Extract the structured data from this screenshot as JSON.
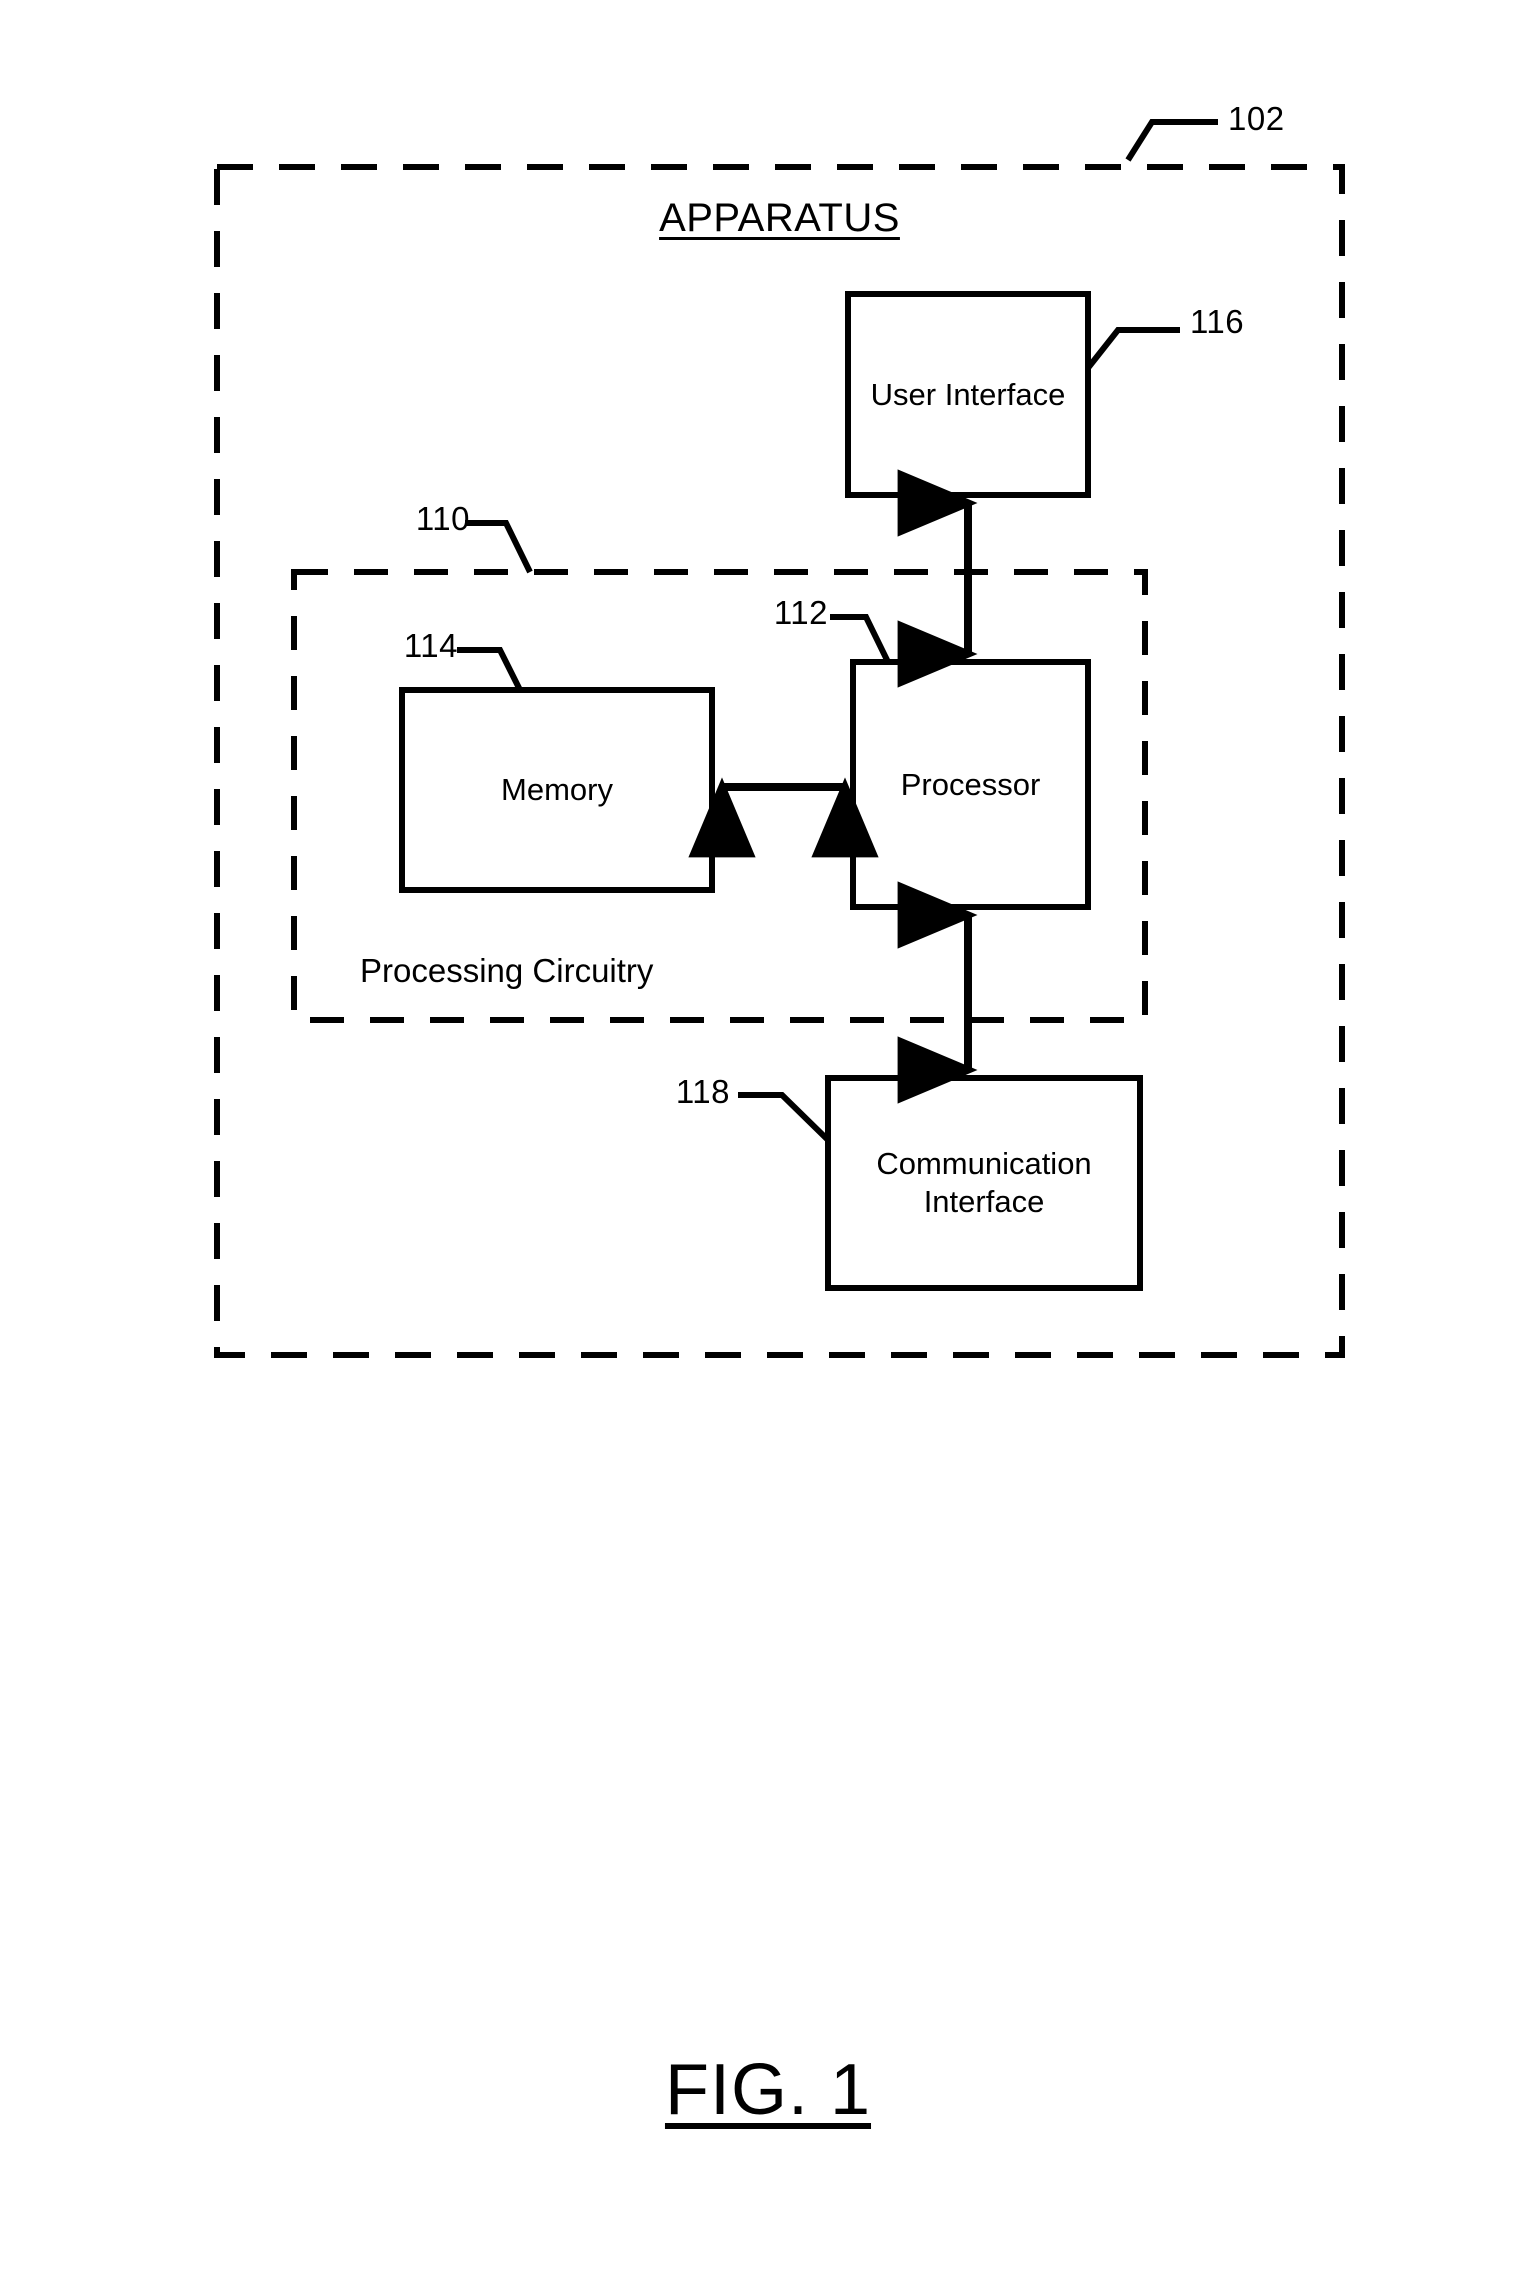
{
  "figure": {
    "caption": "FIG. 1",
    "apparatus_title": "APPARATUS",
    "processing_circuitry_label": "Processing Circuitry",
    "stroke_color": "#000000",
    "background_color": "#ffffff"
  },
  "blocks": {
    "user_interface": {
      "label": "User Interface",
      "ref": "116"
    },
    "processor": {
      "label": "Processor",
      "ref": "112"
    },
    "memory": {
      "label": "Memory",
      "ref": "114"
    },
    "communication_interface": {
      "label": "Communication Interface",
      "ref": "118"
    }
  },
  "regions": {
    "apparatus": {
      "label": "APPARATUS",
      "ref": "102"
    },
    "processing_circuitry": {
      "label": "Processing Circuitry",
      "ref": "110"
    }
  },
  "reference_numerals": {
    "apparatus": "102",
    "processing_circuitry": "110",
    "processor": "112",
    "memory": "114",
    "user_interface": "116",
    "communication_interface": "118"
  },
  "connections": [
    {
      "name": "user-interface-to-processor",
      "from": "User Interface",
      "to": "Processor",
      "style": "double-arrow-vertical"
    },
    {
      "name": "memory-to-processor",
      "from": "Memory",
      "to": "Processor",
      "style": "double-arrow-horizontal"
    },
    {
      "name": "processor-to-communication-interface",
      "from": "Processor",
      "to": "Communication Interface",
      "style": "double-arrow-vertical"
    }
  ]
}
